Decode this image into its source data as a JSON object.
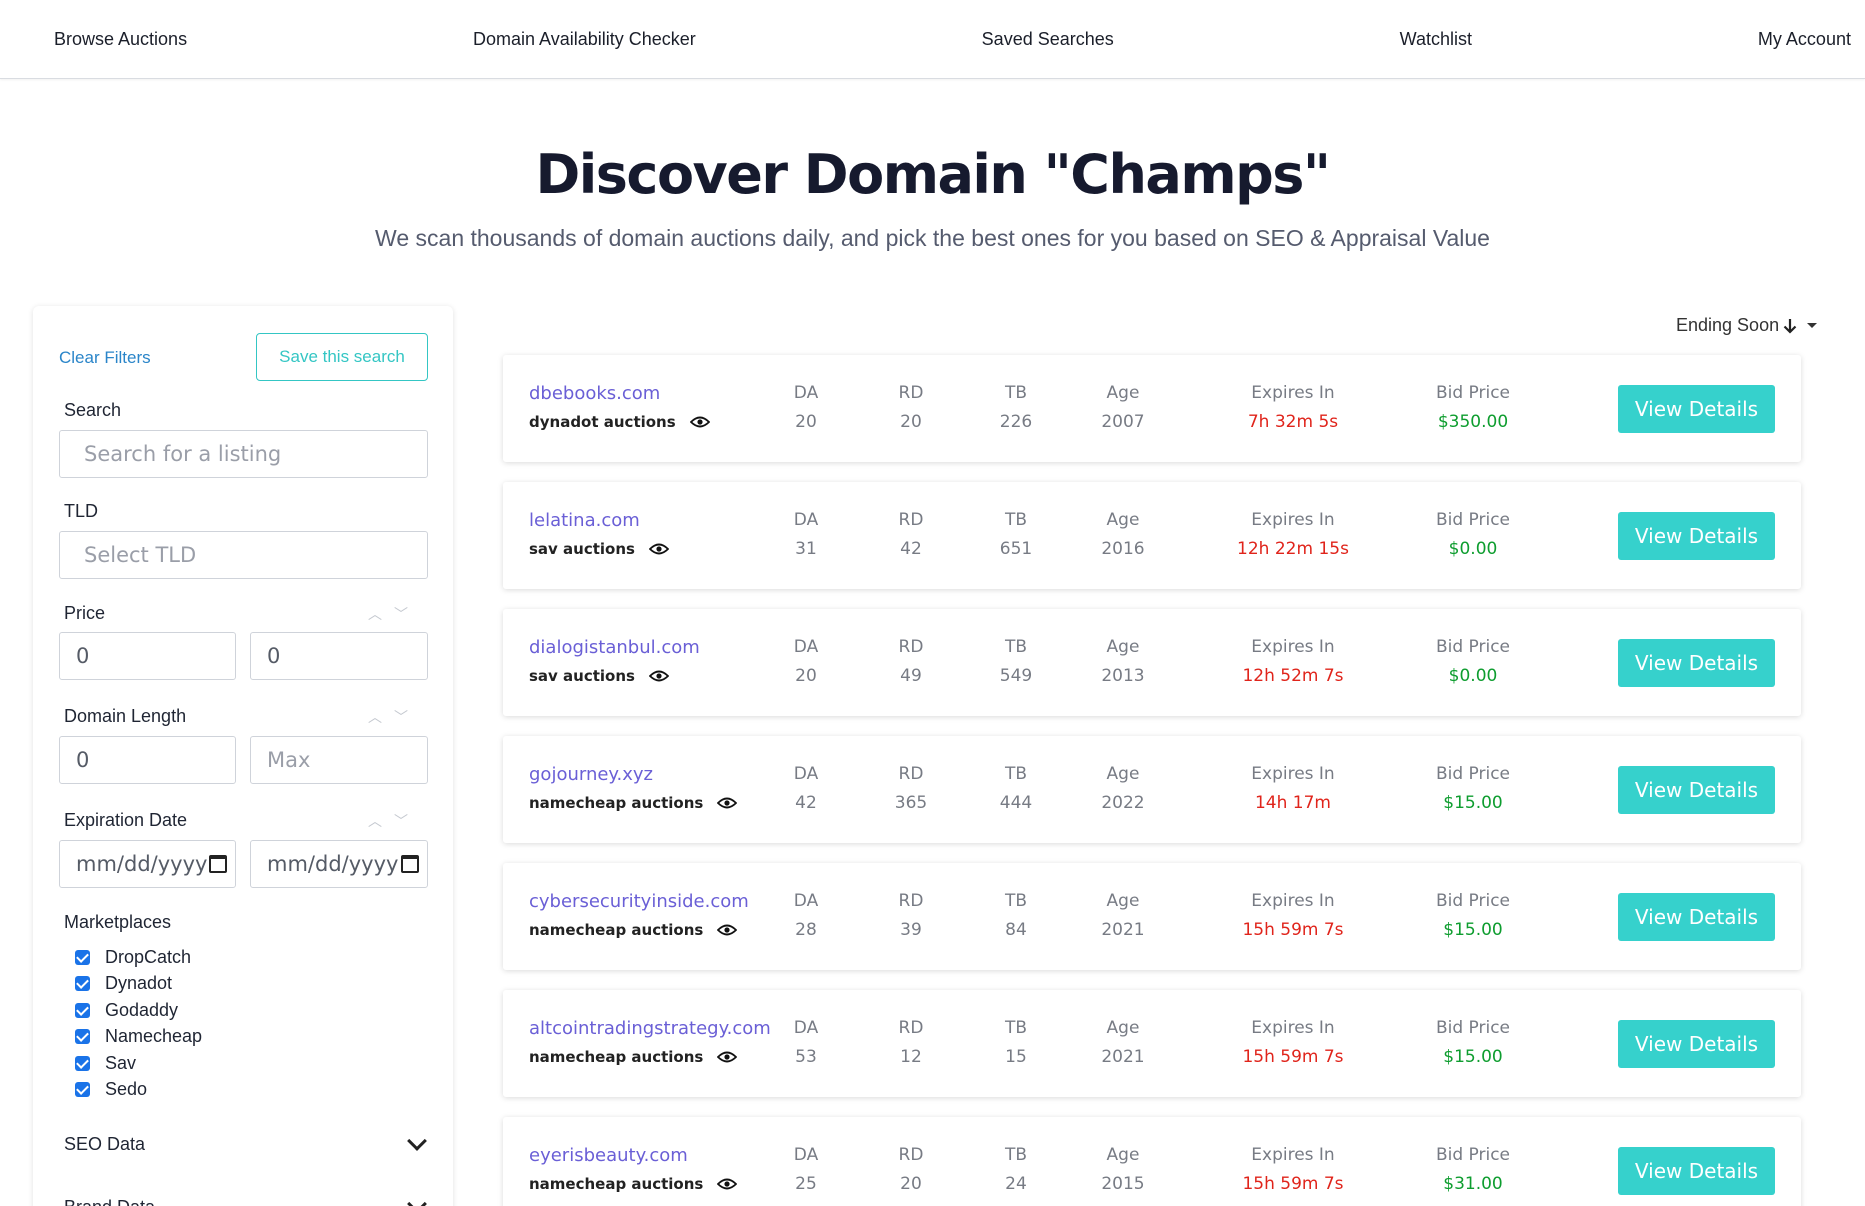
{
  "nav": {
    "items": [
      "Browse Auctions",
      "Domain Availability Checker",
      "Saved Searches",
      "Watchlist",
      "My Account"
    ]
  },
  "hero": {
    "title": "Discover Domain \"Champs\"",
    "subtitle": "We scan thousands of domain auctions daily, and pick the best ones for you based on SEO & Appraisal Value"
  },
  "filters": {
    "clear_label": "Clear Filters",
    "save_label": "Save this search",
    "search_label": "Search",
    "search_placeholder": "Search for a listing",
    "tld_label": "TLD",
    "tld_placeholder": "Select TLD",
    "price_label": "Price",
    "price_min": "0",
    "price_max": "0",
    "length_label": "Domain Length",
    "length_min": "0",
    "length_max_placeholder": "Max",
    "expiration_label": "Expiration Date",
    "date_placeholder": "mm/dd/yyyy",
    "marketplaces_label": "Marketplaces",
    "marketplaces": [
      "DropCatch",
      "Dynadot",
      "Godaddy",
      "Namecheap",
      "Sav",
      "Sedo"
    ],
    "seo_label": "SEO Data",
    "brand_label": "Brand Data"
  },
  "sort": {
    "label": "Ending Soon"
  },
  "columns": {
    "da": "DA",
    "rd": "RD",
    "tb": "TB",
    "age": "Age",
    "expires": "Expires In",
    "bid": "Bid Price"
  },
  "button_label": "View Details",
  "listings": [
    {
      "domain": "dbebooks.com",
      "market": "dynadot auctions",
      "da": "20",
      "rd": "20",
      "tb": "226",
      "age": "2007",
      "expires": "7h 32m 5s",
      "bid": "$350.00"
    },
    {
      "domain": "lelatina.com",
      "market": "sav auctions",
      "da": "31",
      "rd": "42",
      "tb": "651",
      "age": "2016",
      "expires": "12h 22m 15s",
      "bid": "$0.00"
    },
    {
      "domain": "dialogistanbul.com",
      "market": "sav auctions",
      "da": "20",
      "rd": "49",
      "tb": "549",
      "age": "2013",
      "expires": "12h 52m 7s",
      "bid": "$0.00"
    },
    {
      "domain": "gojourney.xyz",
      "market": "namecheap auctions",
      "da": "42",
      "rd": "365",
      "tb": "444",
      "age": "2022",
      "expires": "14h 17m",
      "bid": "$15.00"
    },
    {
      "domain": "cybersecurityinside.com",
      "market": "namecheap auctions",
      "da": "28",
      "rd": "39",
      "tb": "84",
      "age": "2021",
      "expires": "15h 59m 7s",
      "bid": "$15.00"
    },
    {
      "domain": "altcointradingstrategy.com",
      "market": "namecheap auctions",
      "da": "53",
      "rd": "12",
      "tb": "15",
      "age": "2021",
      "expires": "15h 59m 7s",
      "bid": "$15.00"
    },
    {
      "domain": "eyerisbeauty.com",
      "market": "namecheap auctions",
      "da": "25",
      "rd": "20",
      "tb": "24",
      "age": "2015",
      "expires": "15h 59m 7s",
      "bid": "$31.00"
    }
  ]
}
